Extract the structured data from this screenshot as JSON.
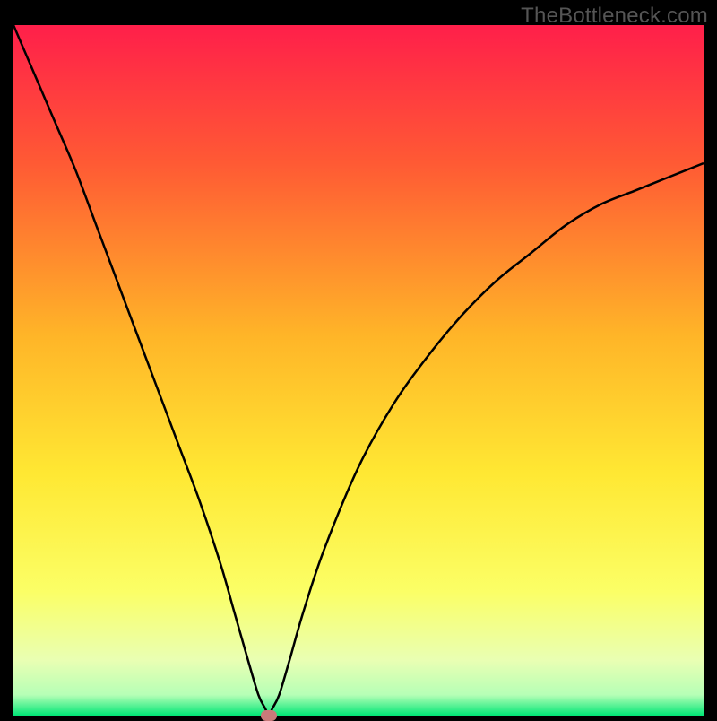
{
  "watermark": "TheBottleneck.com",
  "chart_data": {
    "type": "line",
    "title": "",
    "xlabel": "",
    "ylabel": "",
    "xlim": [
      0,
      100
    ],
    "ylim": [
      0,
      100
    ],
    "x": [
      0,
      3,
      6,
      9,
      12,
      15,
      18,
      21,
      24,
      27,
      30,
      32,
      34,
      35.5,
      36.5,
      37,
      37.5,
      38.5,
      40,
      42,
      45,
      50,
      55,
      60,
      65,
      70,
      75,
      80,
      85,
      90,
      95,
      100
    ],
    "values": [
      100,
      93,
      86,
      79,
      71,
      63,
      55,
      47,
      39,
      31,
      22,
      15,
      8,
      3,
      1,
      0,
      1,
      3,
      8,
      15,
      24,
      36,
      45,
      52,
      58,
      63,
      67,
      71,
      74,
      76,
      78,
      80
    ],
    "gradient_stops": [
      {
        "pos": 0.0,
        "color": "#ff1f4a"
      },
      {
        "pos": 0.2,
        "color": "#ff5a34"
      },
      {
        "pos": 0.45,
        "color": "#ffb528"
      },
      {
        "pos": 0.65,
        "color": "#ffe833"
      },
      {
        "pos": 0.82,
        "color": "#fbff66"
      },
      {
        "pos": 0.92,
        "color": "#e9ffb3"
      },
      {
        "pos": 0.97,
        "color": "#b6ffb6"
      },
      {
        "pos": 1.0,
        "color": "#00e676"
      }
    ],
    "marker": {
      "x": 37,
      "y": 0,
      "color": "#c97a7a"
    }
  }
}
